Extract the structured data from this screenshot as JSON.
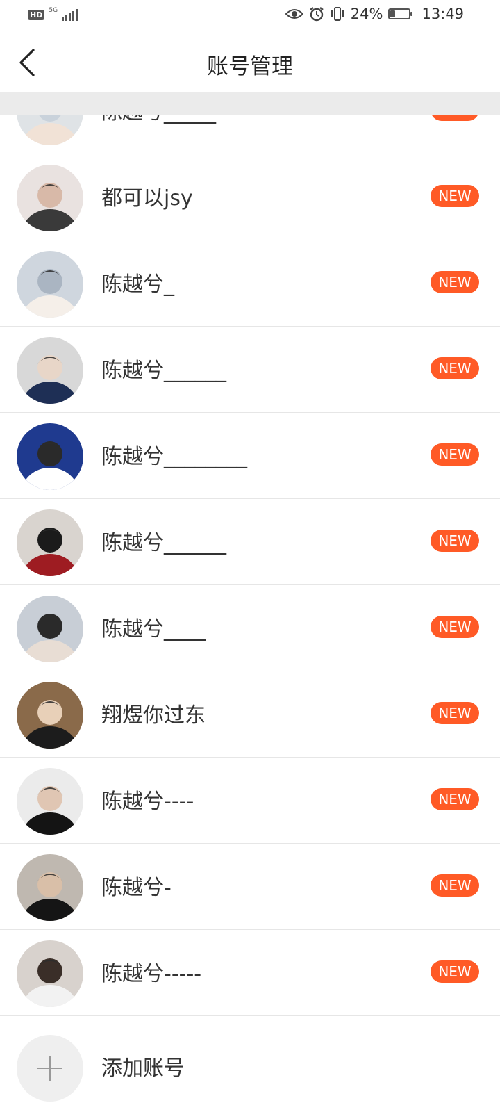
{
  "status_bar": {
    "hd": "HD",
    "network": "5G",
    "battery_text": "24%",
    "battery_level": 0.24,
    "time": "13:49",
    "icons": [
      "eye-icon",
      "alarm-icon",
      "vibrate-icon",
      "battery-icon",
      "signal-icon"
    ]
  },
  "header": {
    "title": "账号管理",
    "back_icon": "chevron-left-icon"
  },
  "accounts": [
    {
      "name": "陈越兮_____",
      "badge": "NEW",
      "avatar_colors": [
        "#dfe3e6",
        "#f1e2d6",
        "#c9d2db"
      ]
    },
    {
      "name": "都可以jsy",
      "badge": "NEW",
      "avatar_colors": [
        "#e9e2e0",
        "#3a3a3a",
        "#d8b9a8"
      ]
    },
    {
      "name": "陈越兮_",
      "badge": "NEW",
      "avatar_colors": [
        "#cfd6de",
        "#f5efe9",
        "#aab5c2"
      ]
    },
    {
      "name": "陈越兮______",
      "badge": "NEW",
      "avatar_colors": [
        "#d8d8d8",
        "#1e2f55",
        "#e8d6c8"
      ]
    },
    {
      "name": "陈越兮________",
      "badge": "NEW",
      "avatar_colors": [
        "#1f3a8f",
        "#ffffff",
        "#2a2a2a"
      ]
    },
    {
      "name": "陈越兮______",
      "badge": "NEW",
      "avatar_colors": [
        "#d9d4cf",
        "#9e1c22",
        "#1b1b1b"
      ]
    },
    {
      "name": "陈越兮____",
      "badge": "NEW",
      "avatar_colors": [
        "#c8ced6",
        "#e8ddd4",
        "#2a2a2a"
      ]
    },
    {
      "name": "翔煜你过东",
      "badge": "NEW",
      "avatar_colors": [
        "#8a6a4a",
        "#1c1c1c",
        "#e8d0b8"
      ]
    },
    {
      "name": "陈越兮----",
      "badge": "NEW",
      "avatar_colors": [
        "#ebebeb",
        "#141414",
        "#e0c6b3"
      ]
    },
    {
      "name": "陈越兮-",
      "badge": "NEW",
      "avatar_colors": [
        "#bfb8b0",
        "#151515",
        "#d9bfa8"
      ]
    },
    {
      "name": "陈越兮-----",
      "badge": "NEW",
      "avatar_colors": [
        "#d8d2cd",
        "#f2f2f2",
        "#3a2e28"
      ]
    }
  ],
  "add_account": {
    "label": "添加账号",
    "icon": "plus-icon"
  },
  "colors": {
    "badge": "#ff5a26",
    "divider": "#e6e6e6",
    "band": "#ebebeb"
  }
}
